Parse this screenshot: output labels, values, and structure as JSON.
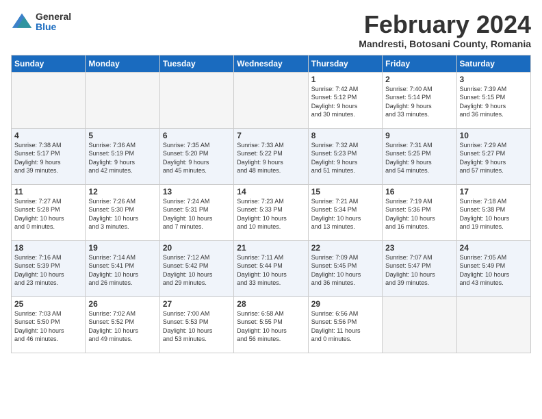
{
  "logo": {
    "general": "General",
    "blue": "Blue"
  },
  "header": {
    "month": "February 2024",
    "location": "Mandresti, Botosani County, Romania"
  },
  "weekdays": [
    "Sunday",
    "Monday",
    "Tuesday",
    "Wednesday",
    "Thursday",
    "Friday",
    "Saturday"
  ],
  "weeks": [
    [
      {
        "day": "",
        "info": ""
      },
      {
        "day": "",
        "info": ""
      },
      {
        "day": "",
        "info": ""
      },
      {
        "day": "",
        "info": ""
      },
      {
        "day": "1",
        "info": "Sunrise: 7:42 AM\nSunset: 5:12 PM\nDaylight: 9 hours\nand 30 minutes."
      },
      {
        "day": "2",
        "info": "Sunrise: 7:40 AM\nSunset: 5:14 PM\nDaylight: 9 hours\nand 33 minutes."
      },
      {
        "day": "3",
        "info": "Sunrise: 7:39 AM\nSunset: 5:15 PM\nDaylight: 9 hours\nand 36 minutes."
      }
    ],
    [
      {
        "day": "4",
        "info": "Sunrise: 7:38 AM\nSunset: 5:17 PM\nDaylight: 9 hours\nand 39 minutes."
      },
      {
        "day": "5",
        "info": "Sunrise: 7:36 AM\nSunset: 5:19 PM\nDaylight: 9 hours\nand 42 minutes."
      },
      {
        "day": "6",
        "info": "Sunrise: 7:35 AM\nSunset: 5:20 PM\nDaylight: 9 hours\nand 45 minutes."
      },
      {
        "day": "7",
        "info": "Sunrise: 7:33 AM\nSunset: 5:22 PM\nDaylight: 9 hours\nand 48 minutes."
      },
      {
        "day": "8",
        "info": "Sunrise: 7:32 AM\nSunset: 5:23 PM\nDaylight: 9 hours\nand 51 minutes."
      },
      {
        "day": "9",
        "info": "Sunrise: 7:31 AM\nSunset: 5:25 PM\nDaylight: 9 hours\nand 54 minutes."
      },
      {
        "day": "10",
        "info": "Sunrise: 7:29 AM\nSunset: 5:27 PM\nDaylight: 9 hours\nand 57 minutes."
      }
    ],
    [
      {
        "day": "11",
        "info": "Sunrise: 7:27 AM\nSunset: 5:28 PM\nDaylight: 10 hours\nand 0 minutes."
      },
      {
        "day": "12",
        "info": "Sunrise: 7:26 AM\nSunset: 5:30 PM\nDaylight: 10 hours\nand 3 minutes."
      },
      {
        "day": "13",
        "info": "Sunrise: 7:24 AM\nSunset: 5:31 PM\nDaylight: 10 hours\nand 7 minutes."
      },
      {
        "day": "14",
        "info": "Sunrise: 7:23 AM\nSunset: 5:33 PM\nDaylight: 10 hours\nand 10 minutes."
      },
      {
        "day": "15",
        "info": "Sunrise: 7:21 AM\nSunset: 5:34 PM\nDaylight: 10 hours\nand 13 minutes."
      },
      {
        "day": "16",
        "info": "Sunrise: 7:19 AM\nSunset: 5:36 PM\nDaylight: 10 hours\nand 16 minutes."
      },
      {
        "day": "17",
        "info": "Sunrise: 7:18 AM\nSunset: 5:38 PM\nDaylight: 10 hours\nand 19 minutes."
      }
    ],
    [
      {
        "day": "18",
        "info": "Sunrise: 7:16 AM\nSunset: 5:39 PM\nDaylight: 10 hours\nand 23 minutes."
      },
      {
        "day": "19",
        "info": "Sunrise: 7:14 AM\nSunset: 5:41 PM\nDaylight: 10 hours\nand 26 minutes."
      },
      {
        "day": "20",
        "info": "Sunrise: 7:12 AM\nSunset: 5:42 PM\nDaylight: 10 hours\nand 29 minutes."
      },
      {
        "day": "21",
        "info": "Sunrise: 7:11 AM\nSunset: 5:44 PM\nDaylight: 10 hours\nand 33 minutes."
      },
      {
        "day": "22",
        "info": "Sunrise: 7:09 AM\nSunset: 5:45 PM\nDaylight: 10 hours\nand 36 minutes."
      },
      {
        "day": "23",
        "info": "Sunrise: 7:07 AM\nSunset: 5:47 PM\nDaylight: 10 hours\nand 39 minutes."
      },
      {
        "day": "24",
        "info": "Sunrise: 7:05 AM\nSunset: 5:49 PM\nDaylight: 10 hours\nand 43 minutes."
      }
    ],
    [
      {
        "day": "25",
        "info": "Sunrise: 7:03 AM\nSunset: 5:50 PM\nDaylight: 10 hours\nand 46 minutes."
      },
      {
        "day": "26",
        "info": "Sunrise: 7:02 AM\nSunset: 5:52 PM\nDaylight: 10 hours\nand 49 minutes."
      },
      {
        "day": "27",
        "info": "Sunrise: 7:00 AM\nSunset: 5:53 PM\nDaylight: 10 hours\nand 53 minutes."
      },
      {
        "day": "28",
        "info": "Sunrise: 6:58 AM\nSunset: 5:55 PM\nDaylight: 10 hours\nand 56 minutes."
      },
      {
        "day": "29",
        "info": "Sunrise: 6:56 AM\nSunset: 5:56 PM\nDaylight: 11 hours\nand 0 minutes."
      },
      {
        "day": "",
        "info": ""
      },
      {
        "day": "",
        "info": ""
      }
    ]
  ]
}
